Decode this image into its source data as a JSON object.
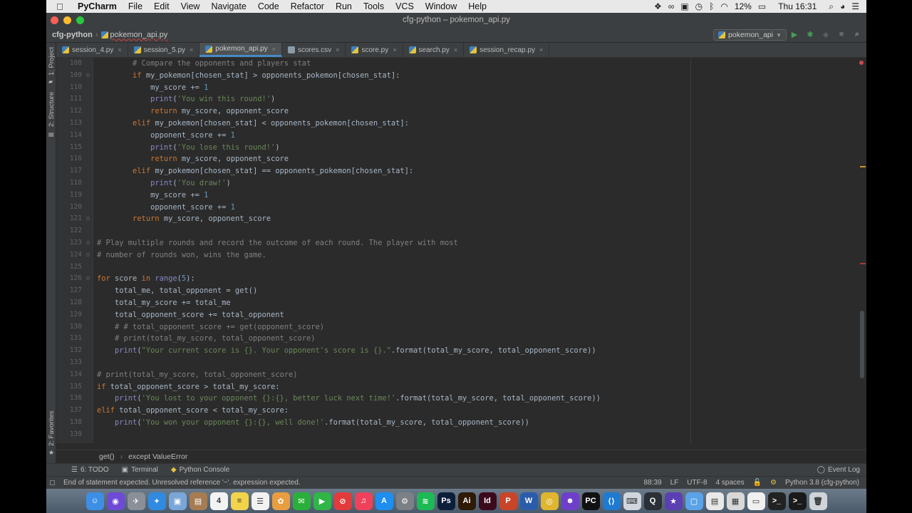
{
  "menubar": {
    "apple": "",
    "items": [
      "PyCharm",
      "File",
      "Edit",
      "View",
      "Navigate",
      "Code",
      "Refactor",
      "Run",
      "Tools",
      "VCS",
      "Window",
      "Help"
    ],
    "battery": "12%",
    "clock": "Thu 16:31"
  },
  "window": {
    "title": "cfg-python – pokemon_api.py"
  },
  "navbar": {
    "project": "cfg-python",
    "file": "pokemon_api.py",
    "run_config": "pokemon_api"
  },
  "sidebar": {
    "project_label": "1: Project",
    "structure_label": "2: Structure",
    "favorites_label": "2: Favorites"
  },
  "tabs": [
    {
      "label": "session_4.py",
      "type": "py",
      "active": false
    },
    {
      "label": "session_5.py",
      "type": "py",
      "active": false
    },
    {
      "label": "pokemon_api.py",
      "type": "py",
      "active": true
    },
    {
      "label": "scores.csv",
      "type": "csv",
      "active": false
    },
    {
      "label": "score.py",
      "type": "py",
      "active": false
    },
    {
      "label": "search.py",
      "type": "py",
      "active": false
    },
    {
      "label": "session_recap.py",
      "type": "py",
      "active": false
    }
  ],
  "editor": {
    "lines": [
      {
        "n": "108",
        "fold": "",
        "html": "        <span class=\"com\"># Compare the opponents and players stat</span>"
      },
      {
        "n": "109",
        "fold": "⊟",
        "html": "        <span class=\"kw\">if</span> my_pokemon[chosen_stat] &gt; opponents_pokemon[chosen_stat]:"
      },
      {
        "n": "110",
        "fold": "",
        "html": "            my_score += <span class=\"num\">1</span>"
      },
      {
        "n": "111",
        "fold": "",
        "html": "            <span class=\"bi\">print</span>(<span class=\"str\">'You win this round!'</span>)"
      },
      {
        "n": "112",
        "fold": "",
        "html": "            <span class=\"kw\">return</span> my_score, opponent_score"
      },
      {
        "n": "113",
        "fold": "",
        "html": "        <span class=\"kw\">elif</span> my_pokemon[chosen_stat] &lt; opponents_pokemon[chosen_stat]:"
      },
      {
        "n": "114",
        "fold": "",
        "html": "            opponent_score += <span class=\"num\">1</span>"
      },
      {
        "n": "115",
        "fold": "",
        "html": "            <span class=\"bi\">print</span>(<span class=\"str\">'You lose this round!'</span>)"
      },
      {
        "n": "116",
        "fold": "",
        "html": "            <span class=\"kw\">return</span> my_score, opponent_score"
      },
      {
        "n": "117",
        "fold": "",
        "html": "        <span class=\"kw\">elif</span> my_pokemon[chosen_stat] == opponents_pokemon[chosen_stat]:"
      },
      {
        "n": "118",
        "fold": "",
        "html": "            <span class=\"bi\">print</span>(<span class=\"str\">'You draw!'</span>)"
      },
      {
        "n": "119",
        "fold": "",
        "html": "            my_score += <span class=\"num\">1</span>"
      },
      {
        "n": "120",
        "fold": "",
        "html": "            opponent_score += <span class=\"num\">1</span>"
      },
      {
        "n": "121",
        "fold": "⊟",
        "html": "        <span class=\"kw\">return</span> my_score, opponent_score"
      },
      {
        "n": "122",
        "fold": "",
        "html": ""
      },
      {
        "n": "123",
        "fold": "⊟",
        "html": "<span class=\"com\"># Play multiple rounds and record the outcome of each round. The player with most</span>"
      },
      {
        "n": "124",
        "fold": "⊟",
        "html": "<span class=\"com\"># number of rounds won, wins the game.</span>"
      },
      {
        "n": "125",
        "fold": "",
        "html": ""
      },
      {
        "n": "126",
        "fold": "⊟",
        "html": "<span class=\"kw\">for</span> score <span class=\"kw\">in</span> <span class=\"bi\">range</span>(<span class=\"num\">5</span>):"
      },
      {
        "n": "127",
        "fold": "",
        "html": "    total_me, total_opponent = get()"
      },
      {
        "n": "128",
        "fold": "",
        "html": "    total_my_score += total_me"
      },
      {
        "n": "129",
        "fold": "",
        "html": "    total_opponent_score += total_opponent"
      },
      {
        "n": "130",
        "fold": "",
        "html": "    <span class=\"com\"># # total_opponent_score += get(opponent_score)</span>"
      },
      {
        "n": "131",
        "fold": "",
        "html": "    <span class=\"com\"># print(total_my_score, total_opponent_score)</span>"
      },
      {
        "n": "132",
        "fold": "",
        "html": "    <span class=\"bi\">print</span>(<span class=\"str\">\"Your current score is {}. Your opponent's score is {}.\"</span>.format(total_my_score, total_opponent_score))"
      },
      {
        "n": "133",
        "fold": "",
        "html": ""
      },
      {
        "n": "134",
        "fold": "",
        "html": "<span class=\"com\"># print(total_my_score, total_opponent_score)</span>"
      },
      {
        "n": "135",
        "fold": "",
        "html": "<span class=\"kw\">if</span> total_opponent_score &gt; total_my_score:"
      },
      {
        "n": "136",
        "fold": "",
        "html": "    <span class=\"bi\">print</span>(<span class=\"str\">'You lost to your opponent {}:{}, better luck next time!'</span>.format(total_my_score, total_opponent_score))"
      },
      {
        "n": "137",
        "fold": "",
        "html": "<span class=\"kw\">elif</span> total_opponent_score &lt; total_my_score:"
      },
      {
        "n": "138",
        "fold": "",
        "html": "    <span class=\"bi\">print</span>(<span class=\"str\">'You won your opponent {}:{}, well done!'</span>.format(total_my_score, total_opponent_score))"
      },
      {
        "n": "139",
        "fold": "",
        "html": ""
      }
    ]
  },
  "breadcrumb": {
    "items": [
      "get()",
      "except ValueError"
    ]
  },
  "toolwindows": {
    "todo": "6: TODO",
    "terminal": "Terminal",
    "console": "Python Console",
    "eventlog": "Event Log"
  },
  "status": {
    "message": "End of statement expected. Unresolved reference '~'. expression expected.",
    "position": "88:39",
    "line_sep": "LF",
    "encoding": "UTF-8",
    "indent": "4 spaces",
    "interpreter": "Python 3.8 (cfg-python)"
  },
  "dock": [
    {
      "name": "finder",
      "glyph": "☺",
      "color": "#3d8fe6"
    },
    {
      "name": "siri",
      "glyph": "◉",
      "color": "#6e4bd6"
    },
    {
      "name": "launchpad",
      "glyph": "✈",
      "color": "#8a8f98"
    },
    {
      "name": "safari",
      "glyph": "✦",
      "color": "#2f8ae0"
    },
    {
      "name": "preview",
      "glyph": "▣",
      "color": "#7aa6d8"
    },
    {
      "name": "contacts",
      "glyph": "▤",
      "color": "#a67c52"
    },
    {
      "name": "calendar",
      "glyph": "4",
      "color": "#f3f3f3"
    },
    {
      "name": "notes",
      "glyph": "≡",
      "color": "#f2d44a"
    },
    {
      "name": "reminders",
      "glyph": "☰",
      "color": "#f2f2f2"
    },
    {
      "name": "photos",
      "glyph": "✿",
      "color": "#e79d40"
    },
    {
      "name": "messages",
      "glyph": "✉",
      "color": "#2ab03a"
    },
    {
      "name": "facetime",
      "glyph": "▶",
      "color": "#2fb548"
    },
    {
      "name": "news",
      "glyph": "⊘",
      "color": "#e33b3b"
    },
    {
      "name": "music",
      "glyph": "♫",
      "color": "#f0415b"
    },
    {
      "name": "appstore",
      "glyph": "A",
      "color": "#1e8ef0"
    },
    {
      "name": "system-prefs",
      "glyph": "⚙",
      "color": "#7b7f86"
    },
    {
      "name": "spotify",
      "glyph": "≋",
      "color": "#1db954"
    },
    {
      "name": "photoshop",
      "glyph": "Ps",
      "color": "#0d1e3a"
    },
    {
      "name": "illustrator",
      "glyph": "Ai",
      "color": "#2e1a05"
    },
    {
      "name": "indesign",
      "glyph": "Id",
      "color": "#3b0a1c"
    },
    {
      "name": "powerpoint",
      "glyph": "P",
      "color": "#c9452a"
    },
    {
      "name": "word",
      "glyph": "W",
      "color": "#2b5cab"
    },
    {
      "name": "chrome",
      "glyph": "◎",
      "color": "#e0b52f"
    },
    {
      "name": "github",
      "glyph": "☻",
      "color": "#6e40c9"
    },
    {
      "name": "pycharm",
      "glyph": "PC",
      "color": "#111111"
    },
    {
      "name": "vscode",
      "glyph": "⟨⟩",
      "color": "#1f7ad1"
    },
    {
      "name": "keynote",
      "glyph": "⌨",
      "color": "#cfd6de"
    },
    {
      "name": "quicktime",
      "glyph": "Q",
      "color": "#2b2f36"
    },
    {
      "name": "imovie",
      "glyph": "★",
      "color": "#5b3fb3"
    },
    {
      "name": "folder",
      "glyph": "▢",
      "color": "#5aa3e8"
    },
    {
      "name": "documents",
      "glyph": "▤",
      "color": "#e8e8e8"
    },
    {
      "name": "preview-doc",
      "glyph": "▦",
      "color": "#d8d8d8"
    },
    {
      "name": "screenshot",
      "glyph": "▭",
      "color": "#f0f0f0"
    },
    {
      "name": "terminal-app",
      "glyph": ">_",
      "color": "#222"
    },
    {
      "name": "terminal-app-2",
      "glyph": ">_",
      "color": "#1a1a1a"
    },
    {
      "name": "trash",
      "glyph": "🗑",
      "color": "#cfd4d9"
    }
  ]
}
